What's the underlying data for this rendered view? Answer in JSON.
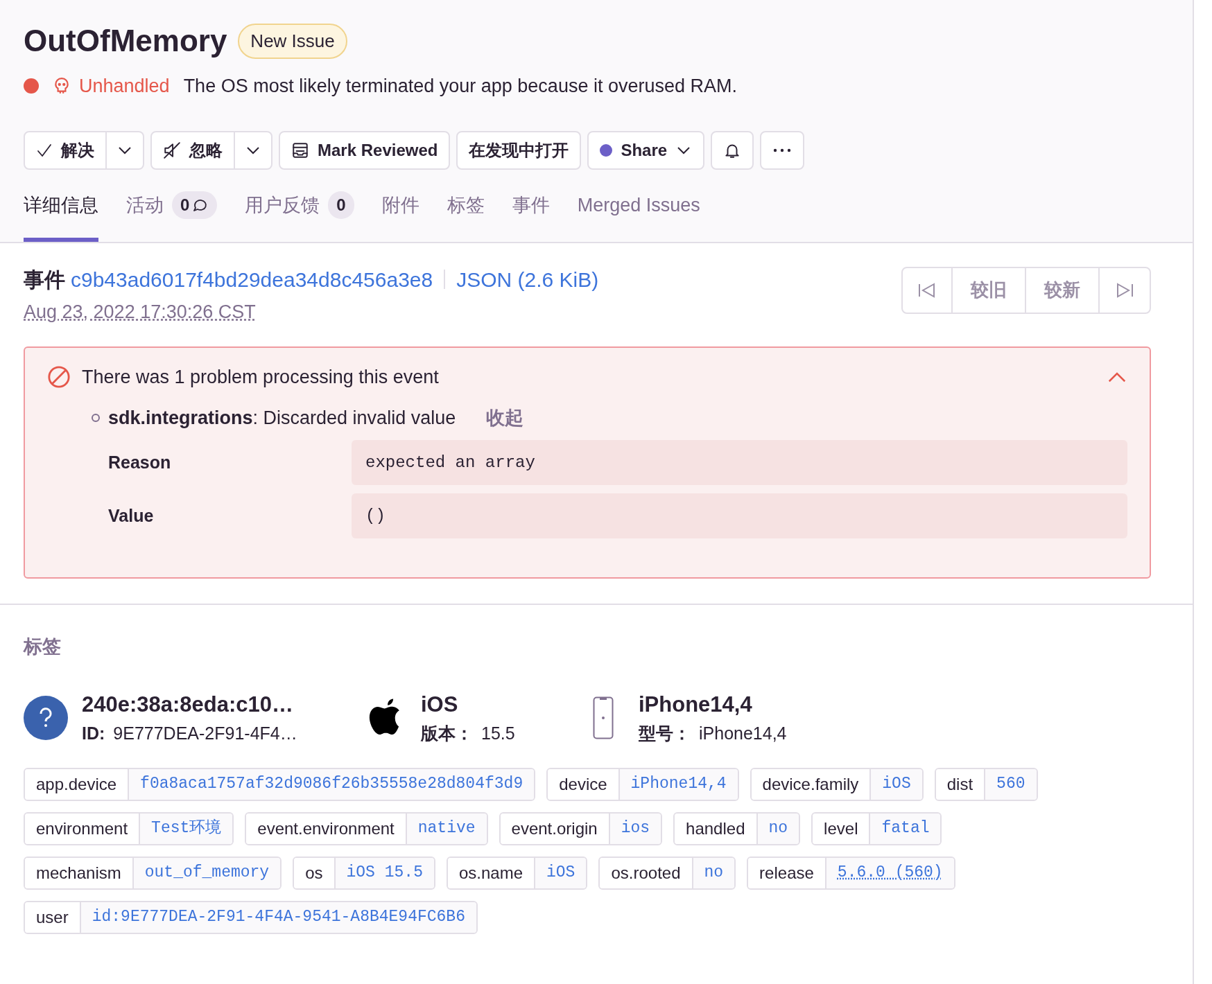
{
  "issue": {
    "title": "OutOfMemory",
    "badge": "New Issue",
    "status": "Unhandled",
    "message": "The OS most likely terminated your app because it overused RAM."
  },
  "actions": [
    {
      "kind": "split",
      "label": "解决"
    },
    {
      "kind": "split",
      "label": "忽略"
    },
    {
      "kind": "button",
      "label": "Mark Reviewed"
    },
    {
      "kind": "button",
      "label": "在发现中打开"
    },
    {
      "kind": "share",
      "label": "Share"
    },
    {
      "kind": "icon"
    },
    {
      "kind": "icon"
    }
  ],
  "tabs": [
    {
      "label": "详细信息",
      "selected": true
    },
    {
      "label": "活动",
      "selected": false,
      "count": "0",
      "comment": true
    },
    {
      "label": "用户反馈",
      "selected": false,
      "count": "0",
      "comment": false
    },
    {
      "label": "附件",
      "selected": false
    },
    {
      "label": "标签",
      "selected": false
    },
    {
      "label": "事件",
      "selected": false
    },
    {
      "label": "Merged Issues",
      "selected": false
    }
  ],
  "event": {
    "label": "事件",
    "id": "c9b43ad6017f4bd29dea34d8c456a3e8",
    "json": "JSON (2.6 KiB)",
    "date": "Aug 23, 2022 17:30:26 CST",
    "nav": [
      "较旧",
      "较新"
    ]
  },
  "problems": {
    "title": "There was 1 problem processing this event",
    "expanded": true,
    "items": [
      {
        "key": "sdk.integrations",
        "message": ": Discarded invalid value",
        "toggle": "收起",
        "details": [
          {
            "label": "Reason",
            "value": "expected an array"
          },
          {
            "label": "Value",
            "value": "()"
          }
        ]
      }
    ]
  },
  "tags_section": {
    "heading": "标签",
    "context": [
      {
        "kind": "user",
        "title": "240e:38a:8eda:c10…",
        "sub_label": "ID:",
        "sub_value": "9E777DEA-2F91-4F4…"
      },
      {
        "kind": "os",
        "title": "iOS",
        "sub_label": "版本：",
        "sub_value": "15.5"
      },
      {
        "kind": "device",
        "title": "iPhone14,4",
        "sub_label": "型号：",
        "sub_value": "iPhone14,4"
      }
    ],
    "tags": [
      {
        "key": "app.device",
        "value": "f0a8aca1757af32d9086f26b35558e28d804f3d9",
        "link": false
      },
      {
        "key": "device",
        "value": "iPhone14,4",
        "link": false
      },
      {
        "key": "device.family",
        "value": "iOS",
        "link": false
      },
      {
        "key": "dist",
        "value": "560",
        "link": false
      },
      {
        "key": "environment",
        "value": "Test环境",
        "link": false
      },
      {
        "key": "event.environment",
        "value": "native",
        "link": false
      },
      {
        "key": "event.origin",
        "value": "ios",
        "link": false
      },
      {
        "key": "handled",
        "value": "no",
        "link": false
      },
      {
        "key": "level",
        "value": "fatal",
        "link": false
      },
      {
        "key": "mechanism",
        "value": "out_of_memory",
        "link": false
      },
      {
        "key": "os",
        "value": "iOS 15.5",
        "link": false
      },
      {
        "key": "os.name",
        "value": "iOS",
        "link": false
      },
      {
        "key": "os.rooted",
        "value": "no",
        "link": false
      },
      {
        "key": "release",
        "value": "5.6.0 (560)",
        "link": true
      },
      {
        "key": "user",
        "value": "id:9E777DEA-2F91-4F4A-9541-A8B4E94FC6B6",
        "link": false
      }
    ]
  }
}
